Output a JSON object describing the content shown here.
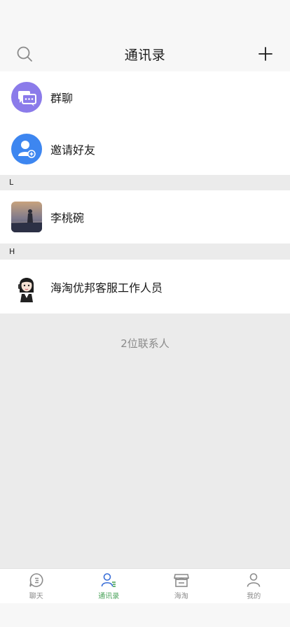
{
  "header": {
    "title": "通讯录",
    "left_icon": "search-icon",
    "right_icon": "plus-icon"
  },
  "top_items": [
    {
      "label": "群聊",
      "icon": "chat-bubbles-icon",
      "color": "#8b7bea"
    },
    {
      "label": "邀请好友",
      "icon": "add-person-icon",
      "color": "#3d86f0"
    }
  ],
  "sections": [
    {
      "header": "L",
      "contacts": [
        {
          "label": "李桃碗",
          "avatar": "photo-avatar"
        }
      ]
    },
    {
      "header": "H",
      "contacts": [
        {
          "label": "海淘优邦客服工作人员",
          "avatar": "cartoon-avatar"
        }
      ]
    }
  ],
  "footer": {
    "count_text": "2位联系人"
  },
  "tabbar": {
    "items": [
      {
        "label": "聊天",
        "icon": "chat-icon",
        "active": false
      },
      {
        "label": "通讯录",
        "icon": "contacts-icon",
        "active": true
      },
      {
        "label": "海淘",
        "icon": "store-icon",
        "active": false
      },
      {
        "label": "我的",
        "icon": "profile-icon",
        "active": false
      }
    ],
    "active_color": "#4aa35a",
    "inactive_color": "#8c8c8c"
  }
}
